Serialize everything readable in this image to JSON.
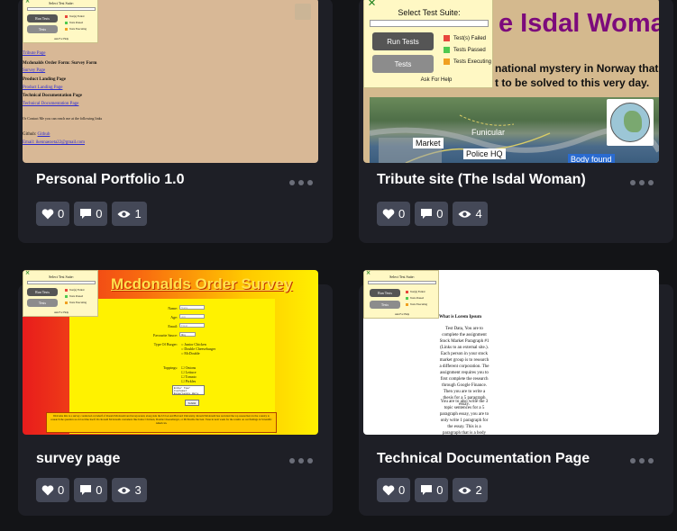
{
  "suite": {
    "title": "Select Test Suite:",
    "run_label": "Run Tests",
    "tests_label": "Tests",
    "legend": [
      {
        "label": "Test(s) Failed",
        "color": "#e8463c"
      },
      {
        "label": "Tests Passed",
        "color": "#4fc94f"
      },
      {
        "label": "Tests Executing",
        "color": "#f0a020"
      }
    ],
    "help": "Ask For Help",
    "close": "×"
  },
  "cards": [
    {
      "title": "Personal Portfolio 1.0",
      "likes": "0",
      "comments": "0",
      "views": "1",
      "preview": {
        "link1": "Tribute Page",
        "heading1": "Mcdonalds Order Form: Survey Form",
        "link2": "Survey Page",
        "heading2": "Product Landing Page",
        "link3": "Product Landing Page",
        "heading3": "Technical Documentation Page",
        "link4": "Technical Documentation Page",
        "contact": "Or Contact Me you can reach me at the following links",
        "github_label": "Github:",
        "github_link": "Github",
        "email": "Email: ikennaezeta22@gmail.com"
      }
    },
    {
      "title": "Tribute site (The Isdal Woman)",
      "likes": "0",
      "comments": "0",
      "views": "4",
      "preview": {
        "heading_partial": "e Isdal Woman",
        "line1": "national mystery in Norway that has",
        "line2": "t to be solved to this very day.",
        "map_labels": [
          "Funicular",
          "Market",
          "Police HQ",
          "Body found"
        ]
      }
    },
    {
      "title": "survey page",
      "likes": "0",
      "comments": "0",
      "views": "3",
      "preview": {
        "heading": "Mcdonalds Order Survey",
        "name_label": "Name:",
        "name_ph": "Name",
        "age_label": "Age:",
        "age_ph": "Age",
        "email_label": "Email:",
        "email_ph": "Email",
        "sauce_label": "Favourite Sauce:",
        "sauce_value": "bbq",
        "burger_label": "Type Of Burger:",
        "burgers": [
          "Junior Chicken",
          "Double Cheeseburger",
          "McDouble"
        ],
        "toppings_label": "Toppings:",
        "toppings": [
          "Onions",
          "Lettuce",
          "Tomato",
          "Pickles"
        ],
        "textarea": "Enter Your Customer Experience Here.",
        "submit": "Submit",
        "footer": "Welcome this is a survey conducted on behalf of Ronald Mcdonald and incorporated, along side the UCLA and Harvard University. Ronald Mcdonald has recruited the top researchers in the country to research the question as old as time itself. Do Ronald Mcdonalds customers like Junior Chicken, Double Cheeseburger, or McDouble the best. Tune in next week for the results on our findings in Scientific American."
      }
    },
    {
      "title": "Technical Documentation Page",
      "likes": "0",
      "comments": "0",
      "views": "2",
      "preview": {
        "heading": "What is Lorem Ipsum",
        "body": "Test Data, You are to complete the assignment Stock Market Paragraph #1 (Links to an external site.). Each person in your stock market group is to research a different corporation. The assignment requires you to first complete the research through Google Finance. Then you are to write a thesis for a 5 paragraph essay.",
        "body2": "You are to also write the 3 topic sentences for a 5 paragraph essay, you are to only write 1 paragraph for the essay. This is a paragraph that is a body paragraph that focuses on"
      }
    }
  ]
}
